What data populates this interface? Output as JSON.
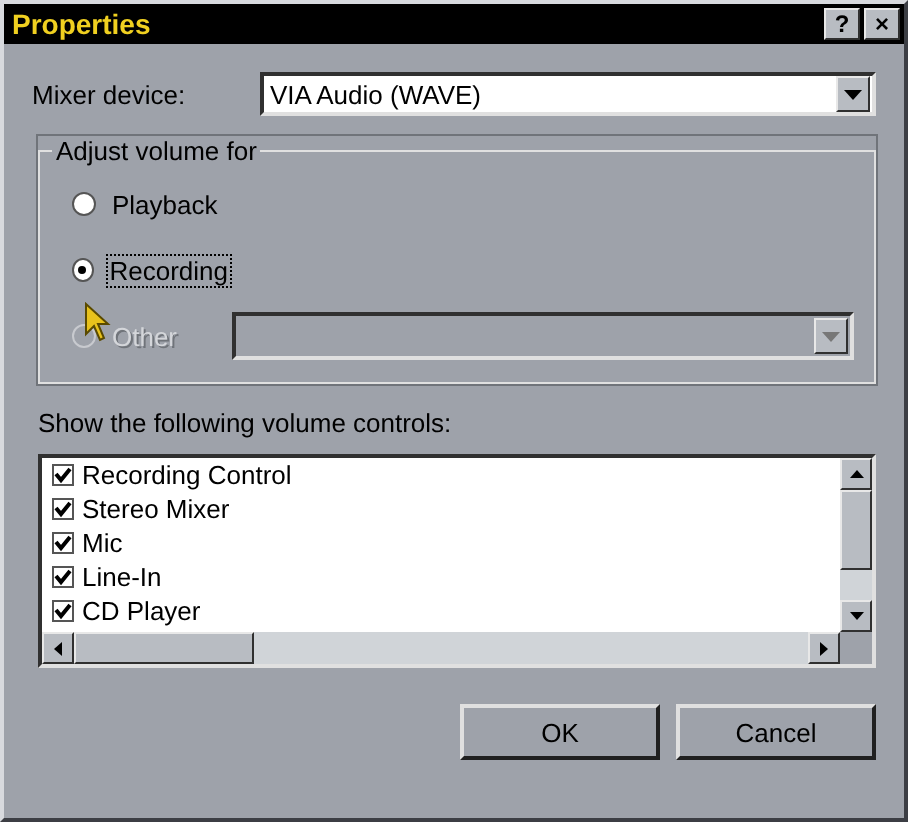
{
  "window": {
    "title": "Properties",
    "buttons": [
      "?",
      "×"
    ]
  },
  "mixer_device": {
    "label": "Mixer device:",
    "value": "VIA Audio (WAVE)"
  },
  "adjust_volume": {
    "title": "Adjust volume for",
    "options": [
      {
        "label": "Playback",
        "selected": false,
        "disabled": false
      },
      {
        "label": "Recording",
        "selected": true,
        "disabled": false
      },
      {
        "label": "Other",
        "selected": false,
        "disabled": true
      }
    ]
  },
  "controls": {
    "label": "Show the following volume controls:",
    "items": [
      {
        "label": "Recording Control",
        "checked": true
      },
      {
        "label": "Stereo Mixer",
        "checked": true
      },
      {
        "label": "Mic",
        "checked": true
      },
      {
        "label": "Line-In",
        "checked": true
      },
      {
        "label": "CD Player",
        "checked": true
      }
    ]
  },
  "buttons": [
    "OK",
    "Cancel"
  ]
}
